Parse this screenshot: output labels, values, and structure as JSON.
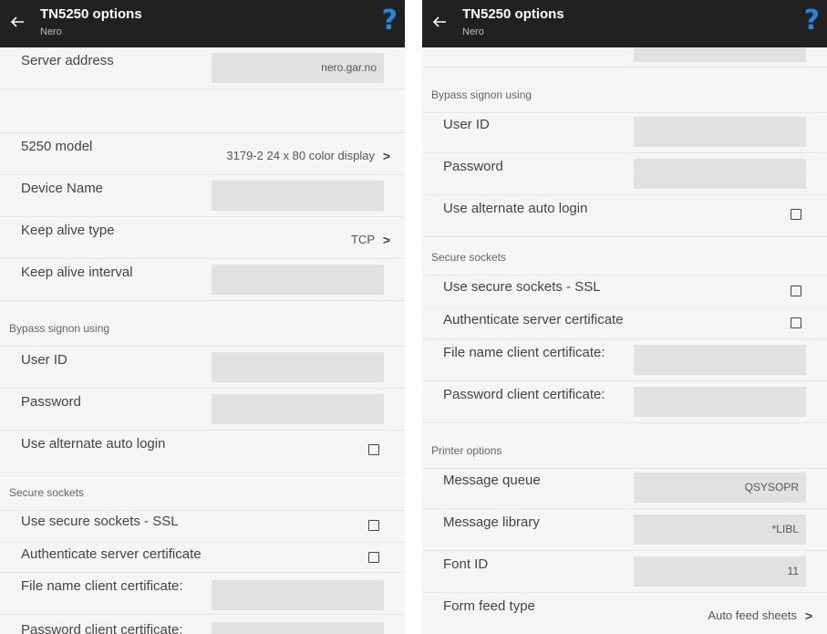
{
  "header": {
    "title": "TN5250 options",
    "subtitle": "Nero",
    "help_label": "?"
  },
  "left": {
    "server_address": {
      "label": "Server address",
      "value": "nero.gar.no"
    },
    "model": {
      "label": "5250 model",
      "value": "3179-2  24 x 80 color display",
      "chevron": ">"
    },
    "device_name": {
      "label": "Device Name",
      "value": ""
    },
    "keep_alive_type": {
      "label": "Keep alive type",
      "value": "TCP",
      "chevron": ">"
    },
    "keep_alive_interval": {
      "label": "Keep alive interval",
      "value": ""
    },
    "bypass_section": "Bypass signon using",
    "user_id": {
      "label": "User ID",
      "value": ""
    },
    "password": {
      "label": "Password",
      "value": ""
    },
    "alt_login": {
      "label": "Use alternate auto login",
      "checked": false
    },
    "secure_section": "Secure sockets",
    "ssl": {
      "label": "Use secure sockets - SSL",
      "checked": false
    },
    "auth_cert": {
      "label": "Authenticate server certificate",
      "checked": false
    },
    "client_cert_file": {
      "label": "File name client certificate:",
      "value": ""
    },
    "client_cert_password": {
      "label": "Password client certificate:",
      "value": ""
    }
  },
  "right": {
    "bypass_section": "Bypass signon using",
    "user_id": {
      "label": "User ID",
      "value": ""
    },
    "password": {
      "label": "Password",
      "value": ""
    },
    "alt_login": {
      "label": "Use alternate auto login",
      "checked": false
    },
    "secure_section": "Secure sockets",
    "ssl": {
      "label": "Use secure sockets - SSL",
      "checked": false
    },
    "auth_cert": {
      "label": "Authenticate server certificate",
      "checked": false
    },
    "client_cert_file": {
      "label": "File name client certificate:",
      "value": ""
    },
    "client_cert_password": {
      "label": "Password client certificate:",
      "value": ""
    },
    "printer_section": "Printer options",
    "message_queue": {
      "label": "Message queue",
      "value": "QSYSOPR"
    },
    "message_library": {
      "label": "Message library",
      "value": "*LIBL"
    },
    "font_id": {
      "label": "Font ID",
      "value": "11"
    },
    "form_feed_type": {
      "label": "Form feed type",
      "value": "Auto feed sheets",
      "chevron": ">"
    }
  },
  "colors": {
    "appbar": "#212121",
    "help": "#1e88e5",
    "background": "#f5f5f5",
    "field": "#e1e1e1"
  }
}
